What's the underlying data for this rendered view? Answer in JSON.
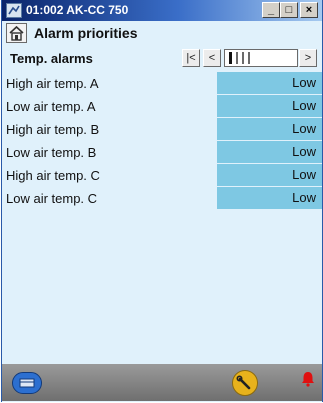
{
  "window": {
    "title": "01:002 AK-CC 750",
    "buttons": {
      "minimize": "_",
      "maximize": "□",
      "close": "×"
    }
  },
  "header": {
    "title": "Alarm priorities"
  },
  "nav": {
    "section_label": "Temp. alarms",
    "first_label": "|<",
    "prev_label": "<",
    "next_label": ">"
  },
  "rows": [
    {
      "label": "High air temp. A",
      "value": "Low"
    },
    {
      "label": "Low air temp. A",
      "value": "Low"
    },
    {
      "label": "High air temp. B",
      "value": "Low"
    },
    {
      "label": "Low air temp. B",
      "value": "Low"
    },
    {
      "label": "High air temp. C",
      "value": "Low"
    },
    {
      "label": "Low air temp. C",
      "value": "Low"
    }
  ],
  "colors": {
    "background": "#e0f1fb",
    "value_cell": "#7ec8e3",
    "bottom_bar": "#808080",
    "alarm": "#e01010"
  },
  "icons": {
    "app": "app-icon",
    "home": "home-icon",
    "menu": "menu-icon",
    "service": "wrench-icon",
    "alarm": "bell-icon"
  }
}
